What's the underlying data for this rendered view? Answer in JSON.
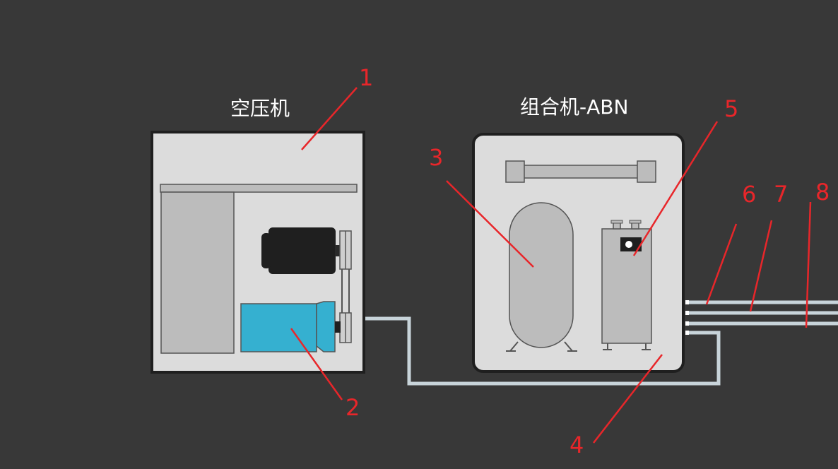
{
  "titles": {
    "compressor": "空压机",
    "combo_unit": "组合机-ABN"
  },
  "callouts": [
    "1",
    "2",
    "3",
    "4",
    "5",
    "6",
    "7",
    "8"
  ],
  "colors": {
    "background": "#383838",
    "panel": "#dcdcdc",
    "panel_border": "#1f1f1f",
    "component_gray": "#bcbcbc",
    "motor": "#1f1f1f",
    "airend_blue": "#35b0d0",
    "pipe": "#c8d4da",
    "callout_red": "#e8262a"
  }
}
